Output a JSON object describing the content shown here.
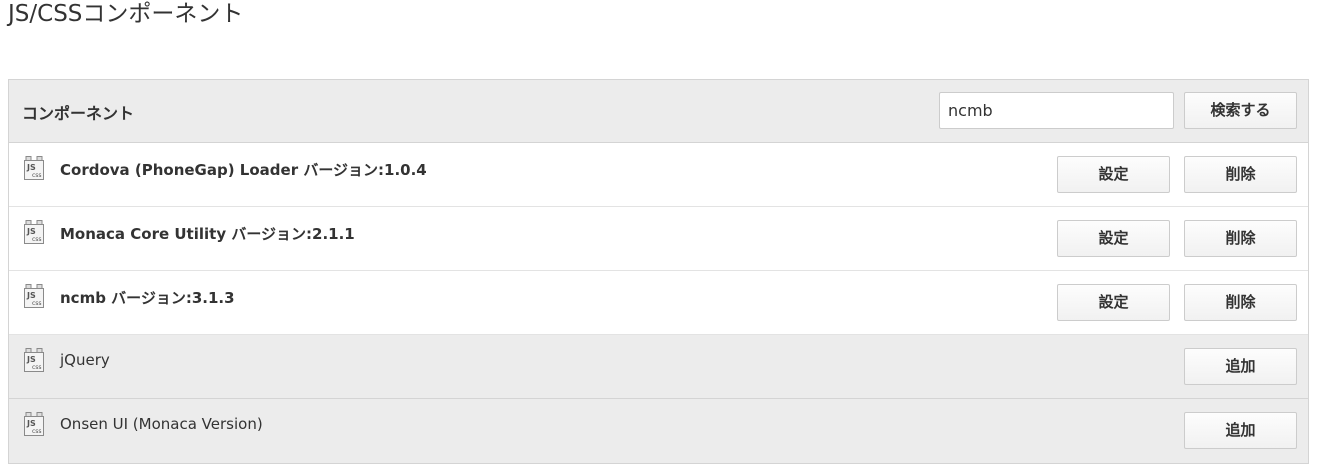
{
  "page_title": "JS/CSSコンポーネント",
  "header": {
    "label": "コンポーネント",
    "search_value": "ncmb",
    "search_button": "検索する"
  },
  "installed": [
    {
      "name": "Cordova (PhoneGap) Loader バージョン:1.0.4",
      "settings_label": "設定",
      "remove_label": "削除",
      "icon": "js-css-file-icon"
    },
    {
      "name": "Monaca Core Utility バージョン:2.1.1",
      "settings_label": "設定",
      "remove_label": "削除",
      "icon": "js-css-file-icon"
    },
    {
      "name": "ncmb バージョン:3.1.3",
      "settings_label": "設定",
      "remove_label": "削除",
      "icon": "js-css-file-icon"
    }
  ],
  "available": [
    {
      "name": "jQuery",
      "add_label": "追加",
      "icon": "js-css-file-icon"
    },
    {
      "name": "Onsen UI (Monaca Version)",
      "add_label": "追加",
      "icon": "js-css-file-icon"
    }
  ]
}
